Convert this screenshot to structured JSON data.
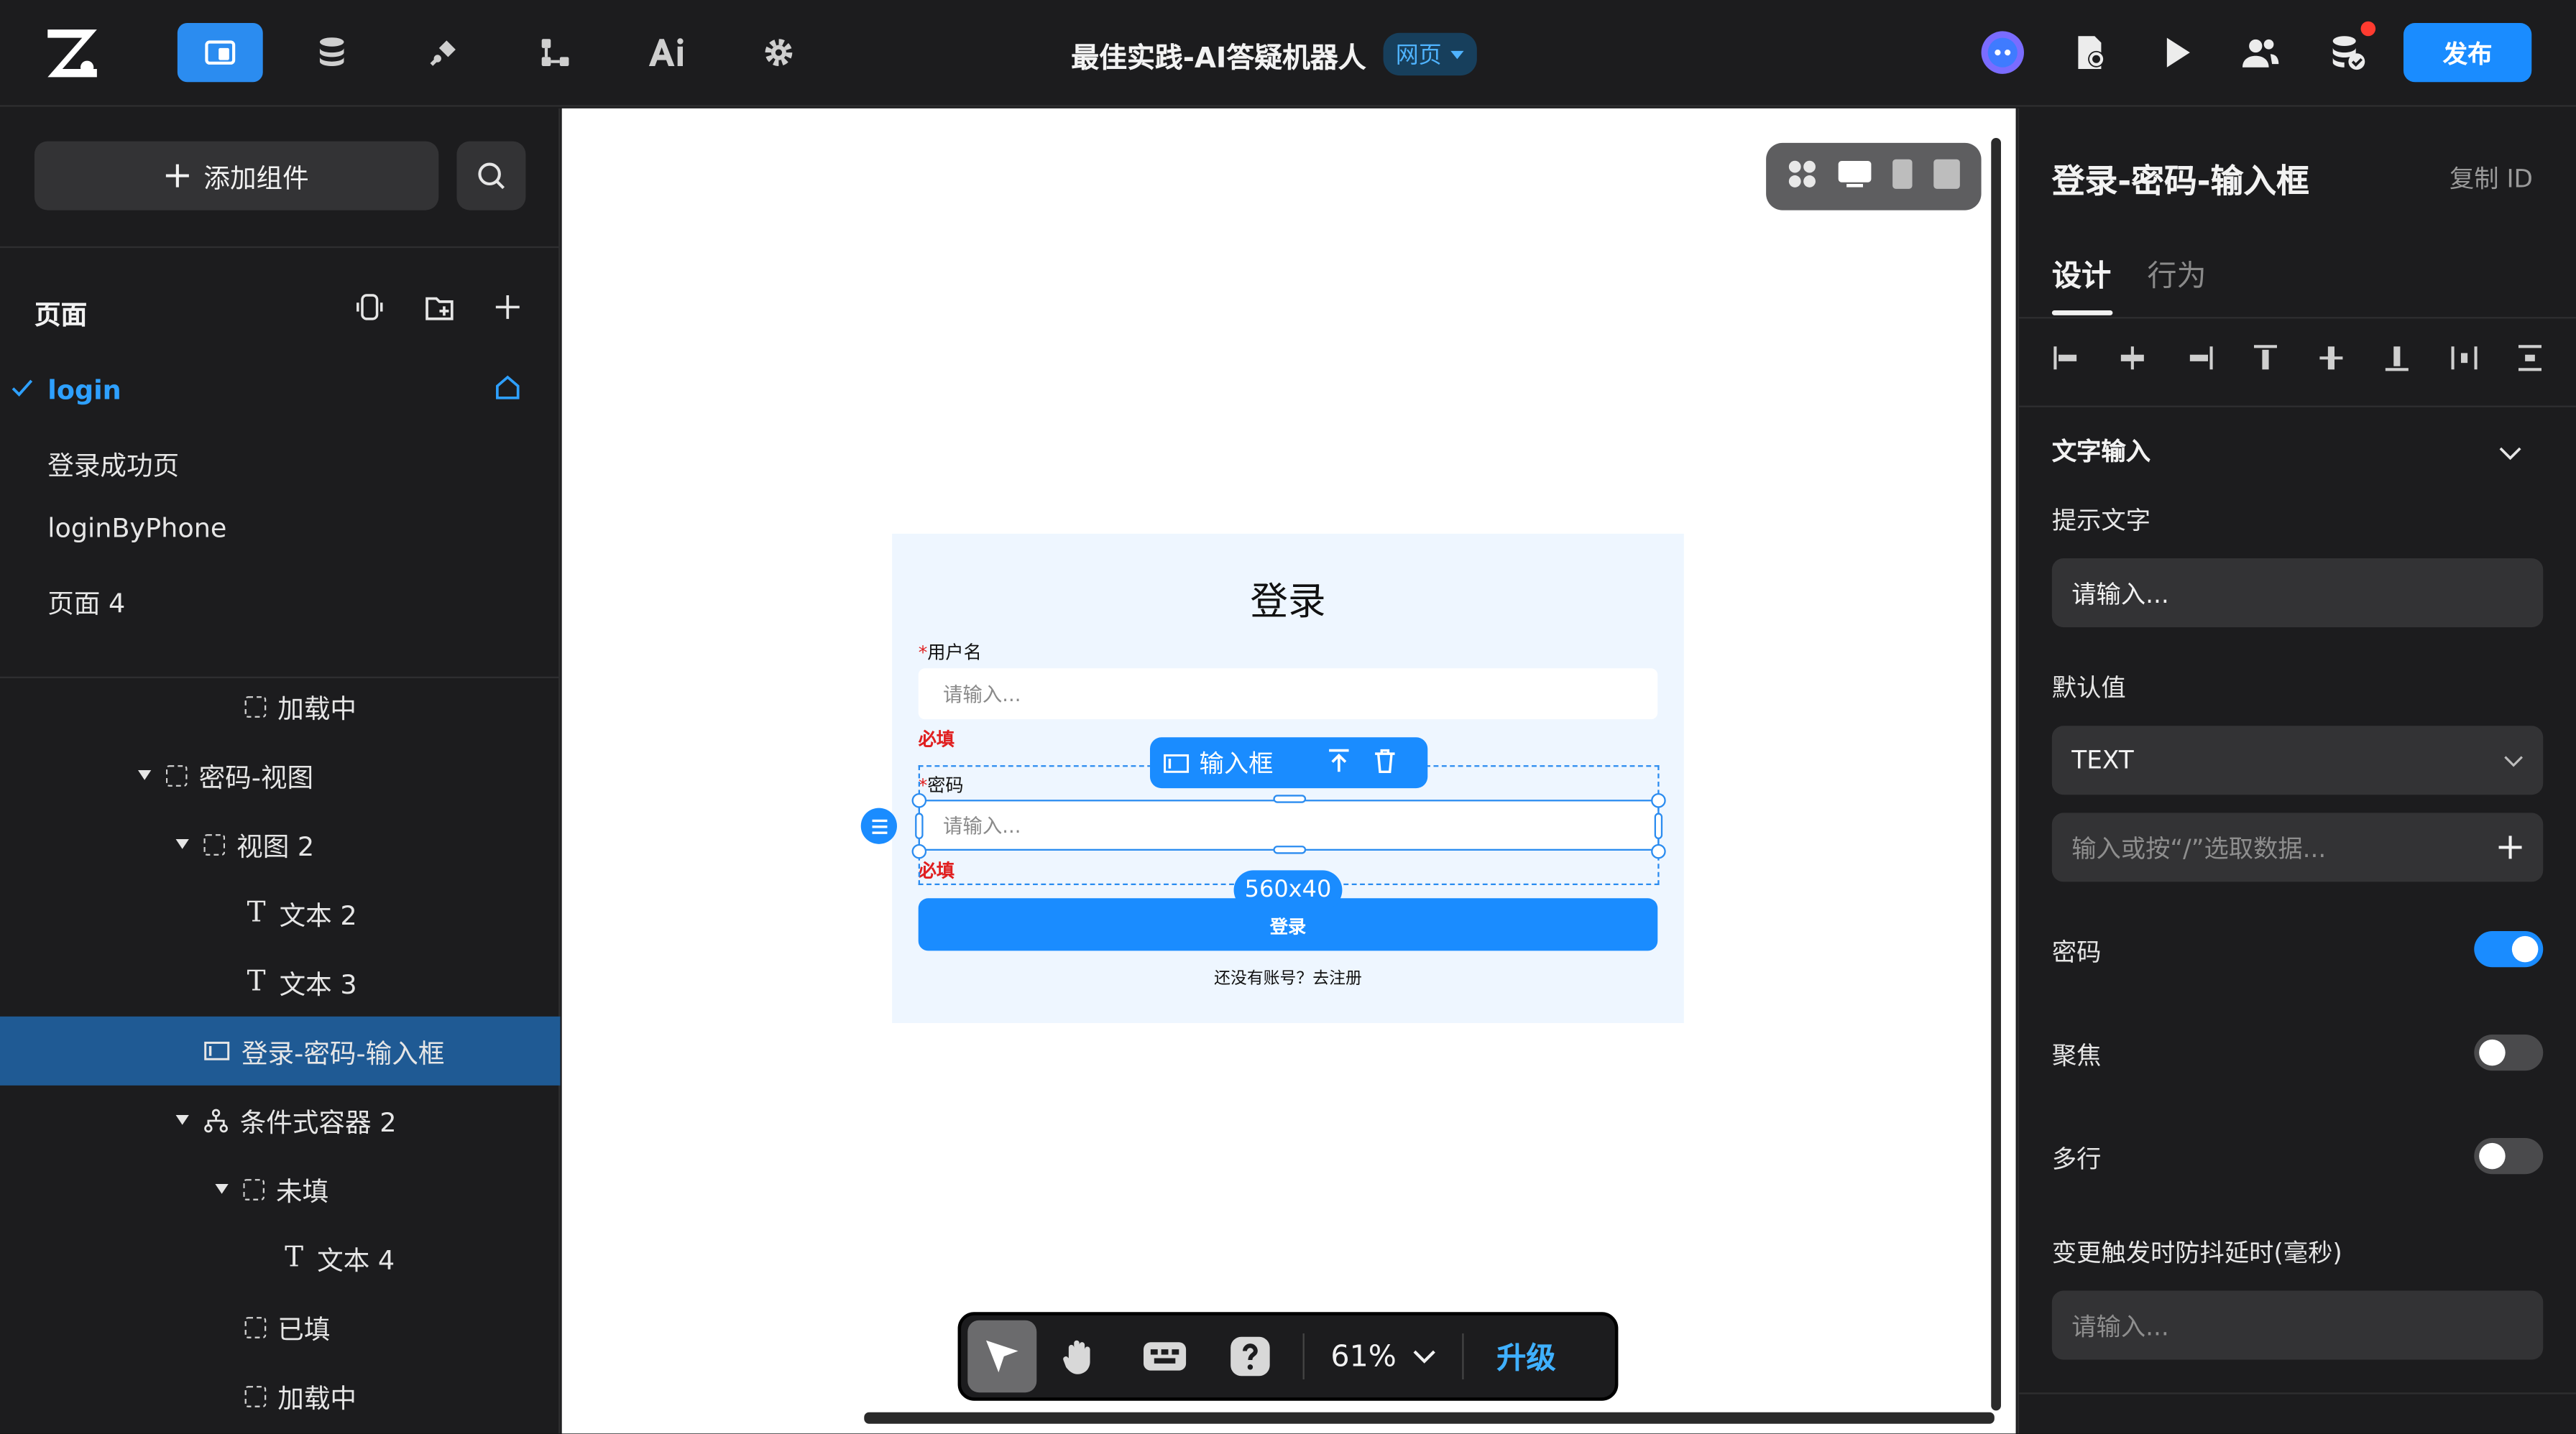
{
  "app": {
    "title": "最佳实践-AI答疑机器人",
    "mode_tag": "网页",
    "publish_label": "发布"
  },
  "left": {
    "add_component_label": "添加组件",
    "pages_heading": "页面",
    "pages": [
      {
        "label": "login",
        "active": true
      },
      {
        "label": "登录成功页"
      },
      {
        "label": "loginByPhone"
      },
      {
        "label": "页面 4"
      }
    ],
    "tree": [
      {
        "label": "加载中",
        "icon": "dashed-box-icon"
      },
      {
        "label": "密码-视图",
        "icon": "dashed-box-icon"
      },
      {
        "label": "视图 2",
        "icon": "dashed-box-icon"
      },
      {
        "label": "文本 2",
        "icon": "text-icon"
      },
      {
        "label": "文本 3",
        "icon": "text-icon"
      },
      {
        "label": "登录-密码-输入框",
        "icon": "input-icon",
        "selected": true
      },
      {
        "label": "条件式容器 2",
        "icon": "branch-icon"
      },
      {
        "label": "未填",
        "icon": "dashed-box-icon"
      },
      {
        "label": "文本 4",
        "icon": "text-icon"
      },
      {
        "label": "已填",
        "icon": "dashed-box-icon"
      },
      {
        "label": "加载中",
        "icon": "dashed-box-icon"
      }
    ]
  },
  "canvas": {
    "form": {
      "title": "登录",
      "username_star": "*",
      "username_label": "用户名",
      "username_placeholder": "请输入...",
      "username_error": "必填",
      "password_star": "*",
      "password_label": "密码",
      "password_placeholder": "请输入...",
      "password_error": "必填",
      "login_button": "登录",
      "register_link": "还没有账号？去注册"
    },
    "selection": {
      "toolbar_label": "输入框",
      "size_badge": "560x40"
    },
    "bottom_toolbar": {
      "zoom": "61%",
      "upgrade_label": "升级"
    }
  },
  "right": {
    "title": "登录-密码-输入框",
    "copy_id_label": "复制 ID",
    "tabs": [
      {
        "label": "设计",
        "active": true
      },
      {
        "label": "行为"
      }
    ],
    "section_title": "文字输入",
    "placeholder_label": "提示文字",
    "placeholder_value": "请输入...",
    "default_label": "默认值",
    "default_type": "TEXT",
    "data_input_placeholder": "输入或按“/”选取数据...",
    "toggles": [
      {
        "label": "密码",
        "on": true
      },
      {
        "label": "聚焦",
        "on": false
      },
      {
        "label": "多行",
        "on": false
      }
    ],
    "debounce_label": "变更触发时防抖延时(毫秒)",
    "debounce_placeholder": "请输入..."
  },
  "colors": {
    "accent": "#1a8cff",
    "panel_bg": "#1c1c1e",
    "selected_row": "#1f5a94",
    "error_red": "#e02020",
    "form_bg": "#eef6ff"
  }
}
